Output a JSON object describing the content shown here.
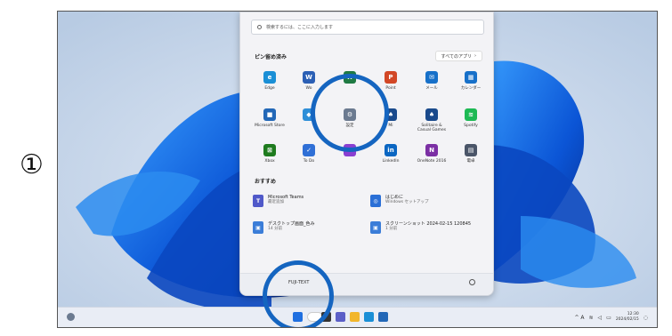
{
  "step_number": "①",
  "search": {
    "placeholder": "検索するには、ここに入力します"
  },
  "pinned": {
    "title": "ピン留め済み",
    "all_apps_label": "すべてのアプリ",
    "all_apps_chevron": "›",
    "apps": [
      {
        "label": "Edge",
        "icon": "edge-icon",
        "color": "#1a8fd6",
        "glyph": "e"
      },
      {
        "label": "Wo",
        "icon": "word-icon",
        "color": "#2b5fb5",
        "glyph": "W"
      },
      {
        "label": "",
        "icon": "excel-icon",
        "color": "#1f7a43",
        "glyph": "X"
      },
      {
        "label": "Point",
        "icon": "powerpoint-icon",
        "color": "#d24726",
        "glyph": "P"
      },
      {
        "label": "メール",
        "icon": "mail-icon",
        "color": "#1770c9",
        "glyph": "✉"
      },
      {
        "label": "カレンダー",
        "icon": "calendar-icon",
        "color": "#1770c9",
        "glyph": "▦"
      },
      {
        "label": "Microsoft Store",
        "icon": "store-icon",
        "color": "#2267b7",
        "glyph": "■"
      },
      {
        "label": "",
        "icon": "photos-icon",
        "color": "#2e8fd8",
        "glyph": "◆"
      },
      {
        "label": "設定",
        "icon": "settings-icon",
        "color": "#6b7a90",
        "glyph": "⚙"
      },
      {
        "label": "Mi",
        "icon": "solitaire-icon",
        "color": "#1a4a8c",
        "glyph": "♠"
      },
      {
        "label": "Solitaire &\nCasual Games",
        "icon": "solitaire-icon",
        "color": "#1a4a8c",
        "glyph": "♠"
      },
      {
        "label": "Spotify",
        "icon": "spotify-icon",
        "color": "#1db954",
        "glyph": "≋"
      },
      {
        "label": "Xbox",
        "icon": "xbox-icon",
        "color": "#1e7b1e",
        "glyph": "⊠"
      },
      {
        "label": "To Do",
        "icon": "todo-icon",
        "color": "#2f6fd6",
        "glyph": "✓"
      },
      {
        "label": "",
        "icon": "clipchamp-icon",
        "color": "#8a3fd1",
        "glyph": "▬"
      },
      {
        "label": "LinkedIn",
        "icon": "linkedin-icon",
        "color": "#0a66c2",
        "glyph": "in"
      },
      {
        "label": "OneNote 2016",
        "icon": "onenote-icon",
        "color": "#7b2fa4",
        "glyph": "N"
      },
      {
        "label": "電卓",
        "icon": "calculator-icon",
        "color": "#4a5568",
        "glyph": "▤"
      }
    ]
  },
  "recommended": {
    "title": "おすすめ",
    "items": [
      {
        "name": "Microsoft Teams",
        "sub": "最近追加",
        "icon": "teams-icon",
        "color": "#5059c9",
        "glyph": "T"
      },
      {
        "name": "はじめに",
        "sub": "Windows セットアップ",
        "icon": "getstarted-icon",
        "color": "#2a6fd6",
        "glyph": "◎"
      },
      {
        "name": "デスクトップ画面_色み",
        "sub": "14 分前",
        "icon": "image-file-icon",
        "color": "#3b7dd8",
        "glyph": "▣"
      },
      {
        "name": "スクリーンショット 2024-02-15 120845",
        "sub": "1 分前",
        "icon": "image-file-icon",
        "color": "#3b7dd8",
        "glyph": "▣"
      }
    ]
  },
  "user": {
    "name": "FUJI-TEXT"
  },
  "taskbar": {
    "icons": [
      "start-icon",
      "search-icon",
      "task-view-icon",
      "chat-icon",
      "explorer-icon",
      "edge-icon",
      "store-icon"
    ],
    "tray_text": "^  A",
    "time": "12:30",
    "date": "2024/02/15"
  }
}
